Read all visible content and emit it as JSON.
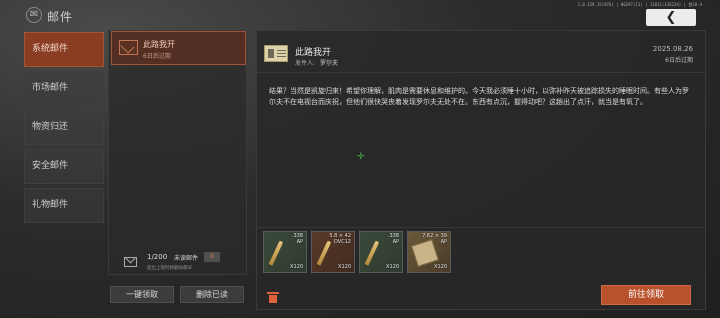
{
  "header": {
    "title": "邮件",
    "version": "1.0.159.15(076) | 06297(I3) | 11011(136224) | 首10-4",
    "back_glyph": "❮"
  },
  "sidebar": {
    "items": [
      {
        "label": "系统邮件",
        "active": true
      },
      {
        "label": "市场邮件",
        "active": false
      },
      {
        "label": "物资归还",
        "active": false
      },
      {
        "label": "安全邮件",
        "active": false
      },
      {
        "label": "礼物邮件",
        "active": false
      }
    ]
  },
  "mail_list": {
    "items": [
      {
        "title": "此路我开",
        "expiry": "6日后过期"
      }
    ]
  },
  "unread": {
    "count": "1/200",
    "label": "未读邮件",
    "badge": "0",
    "note": "超出上限时将删除最早"
  },
  "buttons": {
    "claim_all": "一键领取",
    "delete_read": "删除已读",
    "go_claim": "前往领取"
  },
  "detail": {
    "title": "此路我开",
    "sender_label": "发件人:",
    "sender": "罗尔夫",
    "date": "2025.08.26",
    "expiry": "6日后过期",
    "body": "结果？当然是凯旋归来！希望你理解，肌肉是需要休息和维护的。今天我必须睡十小时，以弥补昨天被追踪损失的睡眠时间。有些人为罗尔夫不在电视台而庆祝，但他们很快哭丧着发现罗尔夫无处不在。东西有点沉，握得动吧？这趟出了点汗，就当是有氧了。",
    "crosshair": "✛"
  },
  "attachments": [
    {
      "label": ".338",
      "label2": "AP",
      "qty": "X120",
      "icon": "bullet-icon"
    },
    {
      "label": "5.8 × 42",
      "label2": "DVC12",
      "qty": "X120",
      "icon": "bullet-icon"
    },
    {
      "label": ".338",
      "label2": "AP",
      "qty": "X120",
      "icon": "bullet-icon"
    },
    {
      "label": "7.62 × 39",
      "label2": "AP",
      "qty": "X120",
      "icon": "ammo-box-icon"
    }
  ],
  "colors": {
    "accent": "#b8512c",
    "active_tab": "#8a3d22",
    "trash": "#e0623a",
    "crosshair": "#4caf50"
  }
}
